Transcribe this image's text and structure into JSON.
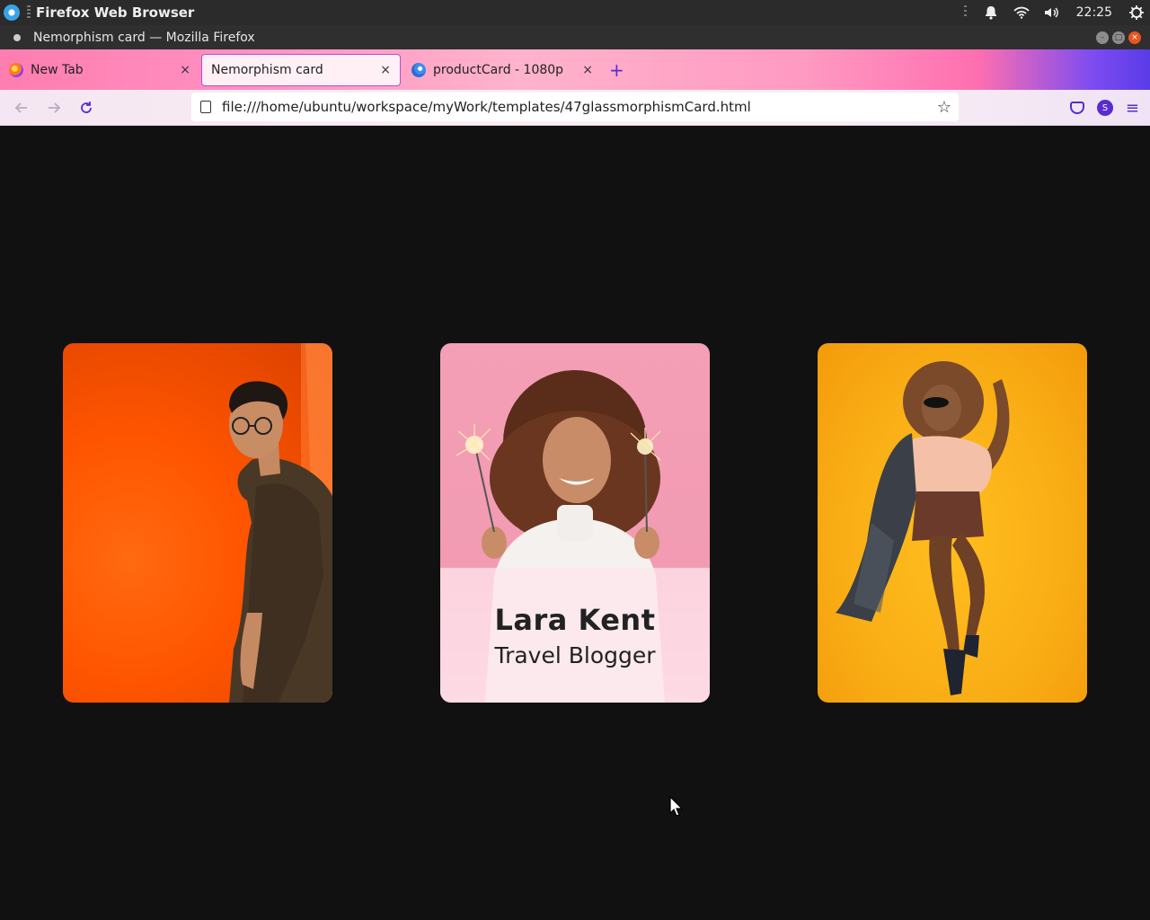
{
  "system_bar": {
    "app_name": "Firefox Web Browser",
    "clock": "22:25",
    "icons": [
      "notification-bell-icon",
      "wifi-icon",
      "volume-icon",
      "power-icon"
    ]
  },
  "window": {
    "title": "Nemorphism card — Mozilla Firefox"
  },
  "tabs": [
    {
      "label": "New Tab",
      "icon": "firefox-icon",
      "active": false
    },
    {
      "label": "Nemorphism card",
      "icon": "",
      "active": true
    },
    {
      "label": "productCard - 1080p",
      "icon": "globe-icon",
      "active": false
    }
  ],
  "nav": {
    "url": "file:///home/ubuntu/workspace/myWork/templates/47glassmorphismCard.html",
    "account_initial": "S"
  },
  "cards": [
    {
      "background_color": "#ff5500",
      "image": "man-in-glasses-against-orange-wall"
    },
    {
      "background_color": "#f29bb2",
      "image": "woman-holding-sparklers",
      "name": "Lara Kent",
      "role": "Travel Blogger"
    },
    {
      "background_color": "#fbb01a",
      "image": "woman-dancing-in-coat"
    }
  ],
  "colors": {
    "page_background": "#111111",
    "accent": "#5a2bd0"
  }
}
